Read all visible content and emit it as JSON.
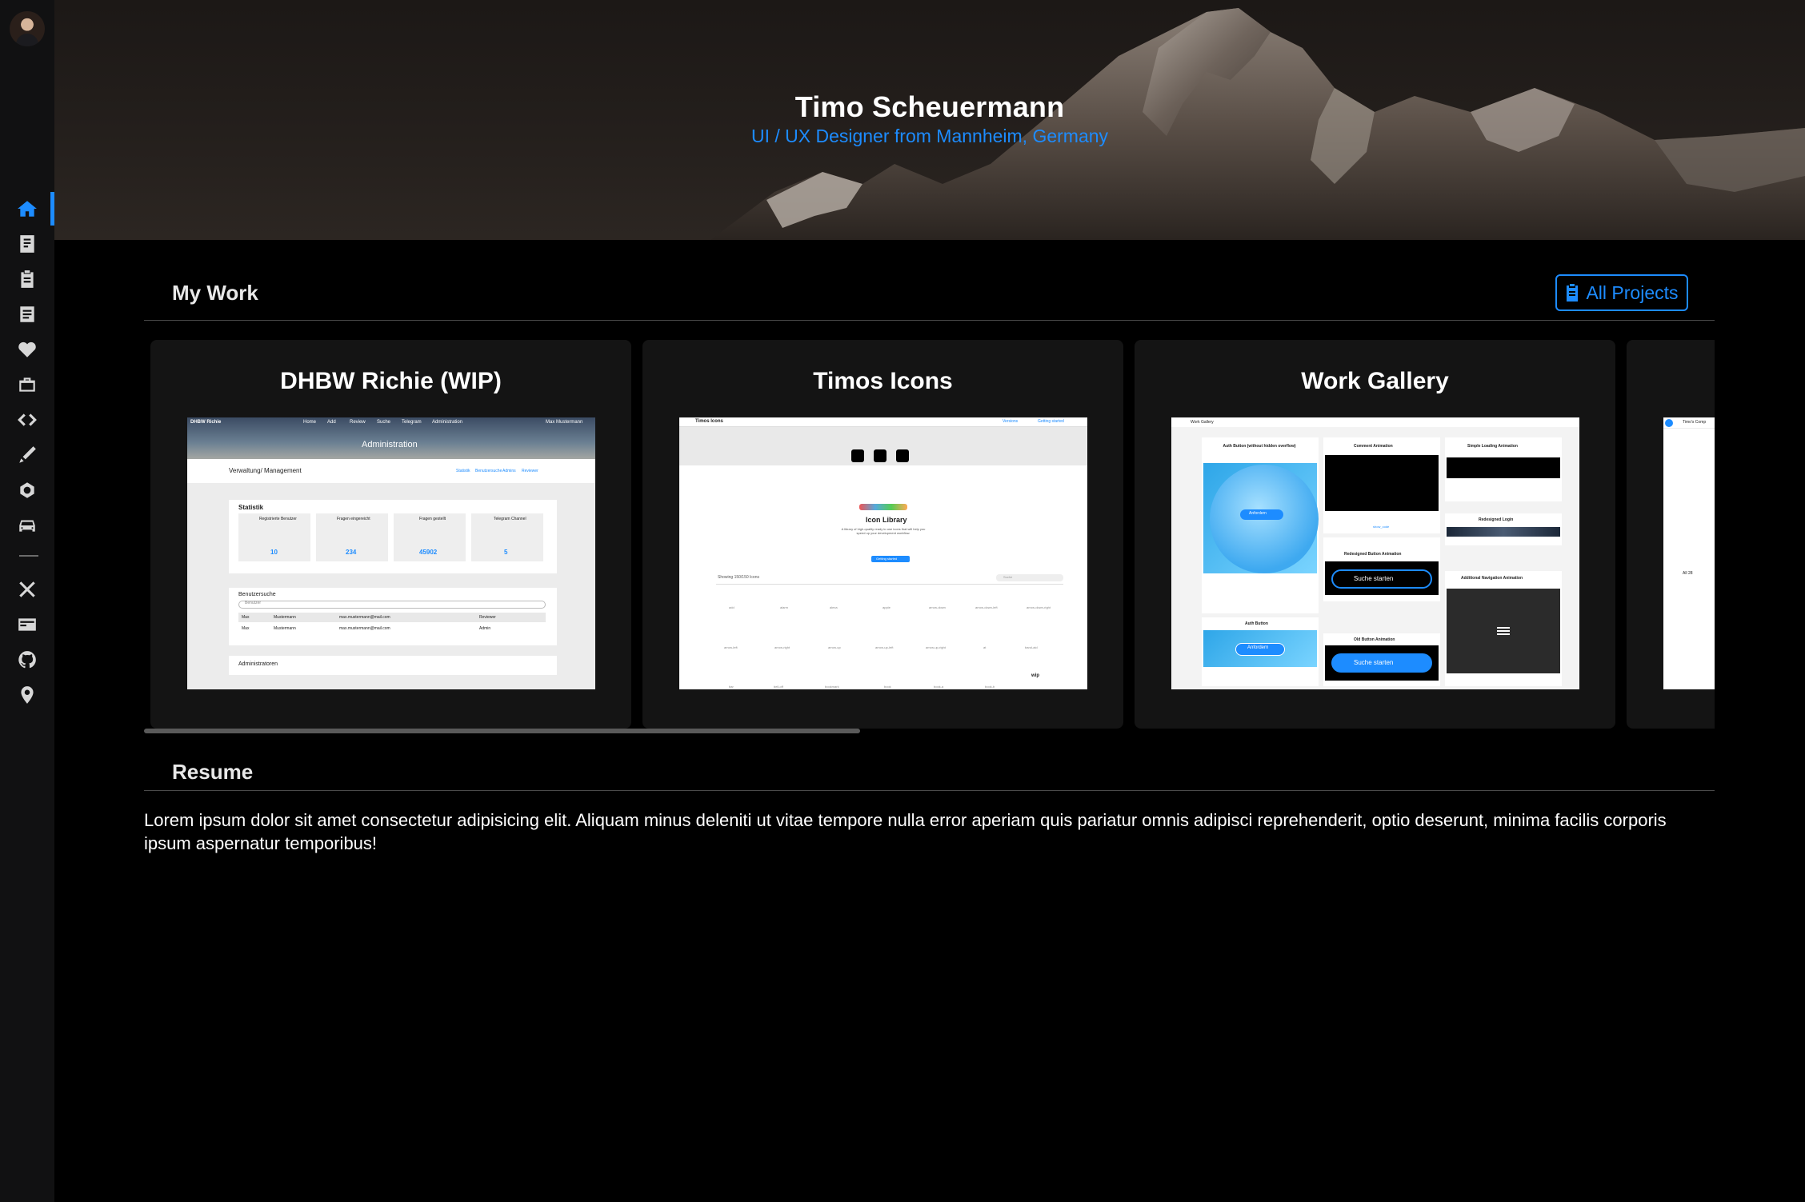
{
  "sidebar": {
    "items": [
      {
        "icon": "home-icon",
        "active": true
      },
      {
        "icon": "blog-icon",
        "active": false
      },
      {
        "icon": "clipboard-icon",
        "active": false
      },
      {
        "icon": "notebook-icon",
        "active": false
      },
      {
        "icon": "heart-icon",
        "active": false
      },
      {
        "icon": "briefcase-icon",
        "active": false
      },
      {
        "icon": "code-icon",
        "active": false
      },
      {
        "icon": "pen-icon",
        "active": false
      },
      {
        "icon": "engine-icon",
        "active": false
      },
      {
        "icon": "car-icon",
        "active": false
      },
      {
        "icon": "tools-icon",
        "active": false
      },
      {
        "icon": "id-card-icon",
        "active": false
      },
      {
        "icon": "github-icon",
        "active": false
      },
      {
        "icon": "location-pin-icon",
        "active": false
      }
    ]
  },
  "hero": {
    "title": "Timo Scheuermann",
    "subtitle": "UI / UX Designer from Mannheim, Germany"
  },
  "work": {
    "title": "My Work",
    "all_projects_label": "All Projects",
    "cards": [
      {
        "title": "DHBW Richie (WIP)",
        "shot": {
          "nav_brand": "DHBW Richie",
          "nav_links": [
            "Home",
            "Add",
            "Review",
            "Suche",
            "Telegram",
            "Administration"
          ],
          "nav_user": "Max Mustermann",
          "banner": "Administration",
          "heading": "Verwaltung/ Management",
          "tabs": [
            "Statistik",
            "Benutzersuche",
            "Admins",
            "Reviewer"
          ],
          "stats_title": "Statistik",
          "stats": [
            {
              "label": "Registrierte Benutzer",
              "value": "10"
            },
            {
              "label": "Fragen eingereicht",
              "value": "234"
            },
            {
              "label": "Fragen gestellt",
              "value": "45902"
            },
            {
              "label": "Telegram Channel",
              "value": "5"
            }
          ],
          "search_title": "Benutzersuche",
          "search_placeholder": "Benutzer",
          "rows": [
            [
              "Max",
              "Mustermann",
              "max.mustermann@mail.com",
              "Reviewer"
            ],
            [
              "Max",
              "Mustermann",
              "max.mustermann@mail.com",
              "Admin"
            ]
          ],
          "admins_title": "Administratoren"
        }
      },
      {
        "title": "Timos Icons",
        "shot": {
          "brand": "Timos Icons",
          "buttons": [
            "Versions",
            "Getting started"
          ],
          "heading": "Icon Library",
          "desc": "A library of high-quality ready to use icons that will help you speed up your development workflow.",
          "cta": "Getting started",
          "count": "Showing 150/150 Icons",
          "search": "Suche",
          "icon_names": [
            "add",
            "alarm",
            "alexa",
            "apple",
            "arrow-down",
            "arrow-down-left",
            "arrow-down-right",
            "arrow-left",
            "arrow-right",
            "arrow-up",
            "arrow-up-left",
            "arrow-up-right",
            "at",
            "band-aid",
            "bar",
            "bell-off",
            "bookmark",
            "book",
            "book-a",
            "book-b",
            "wip"
          ]
        }
      },
      {
        "title": "Work Gallery",
        "shot": {
          "brand": "Work Gallery",
          "tiles": [
            "Auth Button (without hidden overflow)",
            "Comment Animation",
            "Simple Loading Animation",
            "Redesigned Login",
            "Redesigned Button Animation",
            "Additional Navigation Animation",
            "Auth Button",
            "Old Button Animation"
          ],
          "button_label": "Anfordern",
          "search_label": "Suche starten",
          "tag": "show_code"
        }
      },
      {
        "title": "",
        "shot": {
          "brand": "Timo's Comp",
          "note": "All 28"
        }
      }
    ]
  },
  "resume": {
    "title": "Resume",
    "text": "Lorem ipsum dolor sit amet consectetur adipisicing elit. Aliquam minus deleniti ut vitae tempore nulla error aperiam quis pariatur omnis adipisci reprehenderit, optio deserunt, minima facilis corporis ipsum aspernatur temporibus!"
  },
  "colors": {
    "accent": "#1d8cff",
    "background": "#000000",
    "sidebar": "#111112",
    "card": "#141414"
  }
}
